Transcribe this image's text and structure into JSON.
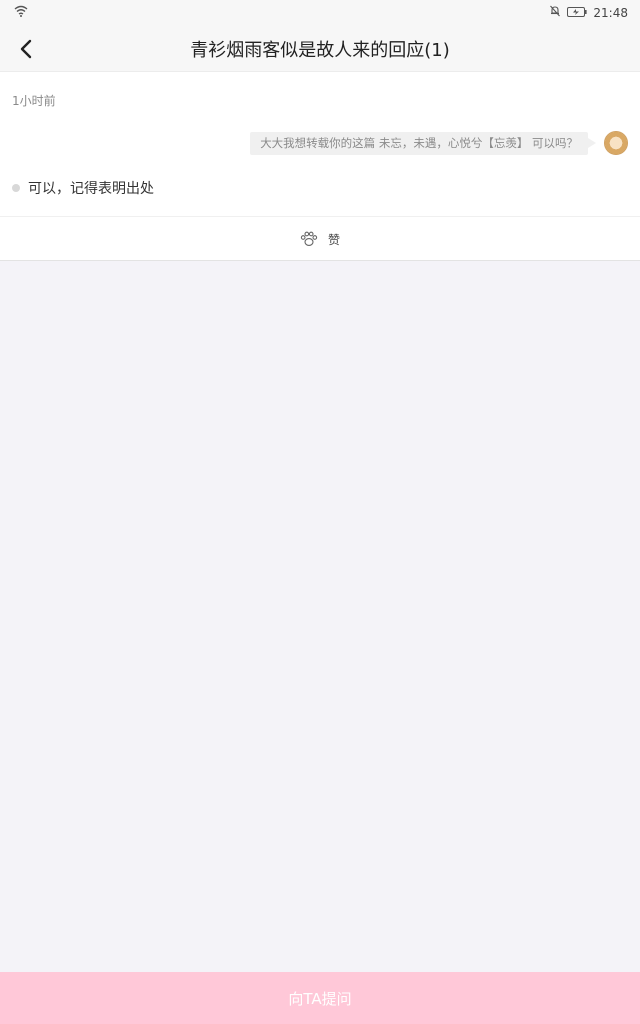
{
  "status_bar": {
    "time": "21:48",
    "icons": [
      "wifi-icon",
      "bell-off-icon",
      "battery-charging-icon"
    ]
  },
  "nav": {
    "back_icon": "chevron-left-icon",
    "title": "青衫烟雨客似是故人来的回应(1)"
  },
  "post": {
    "timestamp": "1小时前",
    "question": "大大我想转载你的这篇 未忘，未遇，心悦兮【忘羡】 可以吗？",
    "answer": "可以，记得表明出处",
    "like_icon": "paw-icon",
    "like_label": "赞"
  },
  "footer": {
    "ask_label": "向TA提问"
  },
  "colors": {
    "page_bg": "#f4f3f8",
    "ask_button_bg": "#ffc8d8"
  }
}
